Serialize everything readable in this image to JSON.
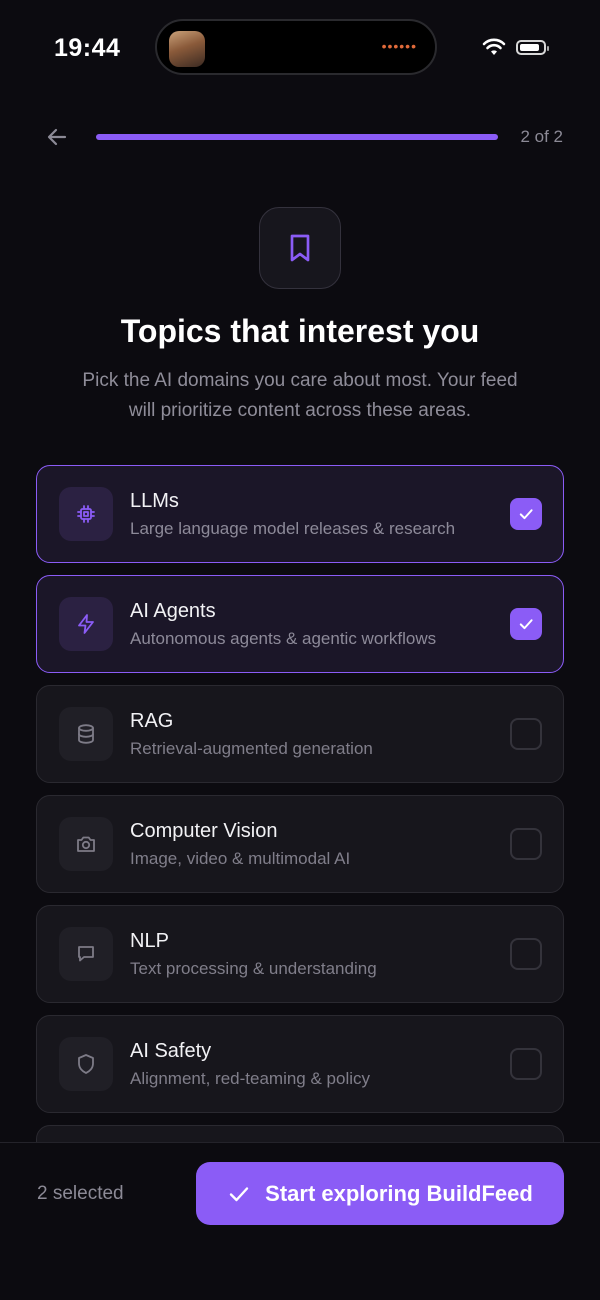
{
  "status_bar": {
    "time": "19:44"
  },
  "header": {
    "step_counter": "2 of 2",
    "progress": 1.0
  },
  "hero": {
    "icon": "bookmark-icon",
    "title": "Topics that interest you",
    "subtitle": "Pick the AI domains you care about most. Your feed will prioritize content across these areas."
  },
  "topics": [
    {
      "title": "LLMs",
      "description": "Large language model releases & research",
      "icon": "chip-icon",
      "selected": true
    },
    {
      "title": "AI Agents",
      "description": "Autonomous agents & agentic workflows",
      "icon": "lightning-icon",
      "selected": true
    },
    {
      "title": "RAG",
      "description": "Retrieval-augmented generation",
      "icon": "database-icon",
      "selected": false
    },
    {
      "title": "Computer Vision",
      "description": "Image, video & multimodal AI",
      "icon": "camera-icon",
      "selected": false
    },
    {
      "title": "NLP",
      "description": "Text processing & understanding",
      "icon": "chat-bubble-icon",
      "selected": false
    },
    {
      "title": "AI Safety",
      "description": "Alignment, red-teaming & policy",
      "icon": "shield-icon",
      "selected": false
    }
  ],
  "footer": {
    "selected_count": "2 selected",
    "cta_label": "Start exploring BuildFeed"
  },
  "colors": {
    "accent": "#8b5cf6",
    "background": "#0c0b10",
    "card": "#17161c"
  }
}
